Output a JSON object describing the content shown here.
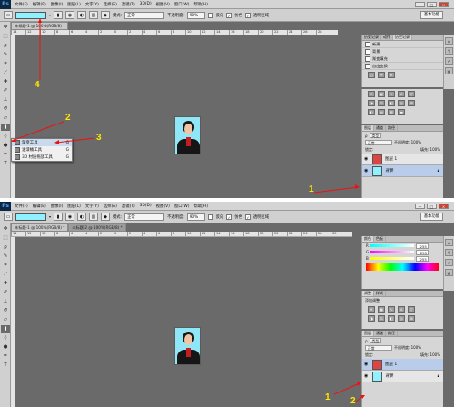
{
  "app": {
    "logo": "Ps"
  },
  "menu": [
    "文件(F)",
    "编辑(E)",
    "图像(I)",
    "图层(L)",
    "文字(Y)",
    "选择(S)",
    "滤镜(T)",
    "3D(D)",
    "视图(V)",
    "窗口(W)",
    "帮助(H)"
  ],
  "window_controls": [
    "—",
    "□",
    "×"
  ],
  "options": {
    "mode_label": "模式:",
    "mode_value": "正常",
    "opacity_label": "不透明度:",
    "opacity_value": "90%",
    "reverse_label": "反向",
    "dither_label": "仿色",
    "transparency_label": "透明区域",
    "workspace": "基本功能"
  },
  "screen1": {
    "tab": "未标题-1 @ 100%(RGB/8) *",
    "flyout": [
      {
        "label": "渐变工具",
        "key": "G"
      },
      {
        "label": "油漆桶工具",
        "key": "G"
      },
      {
        "label": "3D 材质拖放工具",
        "key": "G"
      }
    ],
    "history_tabs": [
      "历史记录",
      "动作",
      "历史记录"
    ],
    "history_items": [
      "新建",
      "背景",
      "渐变填充",
      "自由变换"
    ],
    "layers_tabs": [
      "图层",
      "通道",
      "路径"
    ],
    "layers_kind": "类型",
    "layers_blend": "正常",
    "layers_opacity": "不透明度: 100%",
    "layers_lock": "锁定:",
    "layers_fill": "填充: 100%",
    "layers": [
      {
        "name": "图层 1"
      },
      {
        "name": "背景"
      }
    ],
    "annotations": [
      "1",
      "2",
      "3",
      "4"
    ]
  },
  "screen2": {
    "tabs": [
      "未标题-1 @ 100%(RGB/8) *",
      "未标题-2 @ 100%(RGB/8) *"
    ],
    "color_tabs": [
      "颜色",
      "色板"
    ],
    "sliders": [
      {
        "label": "R",
        "value": "255"
      },
      {
        "label": "G",
        "value": "255"
      },
      {
        "label": "B",
        "value": "255"
      }
    ],
    "adjust_tabs": [
      "调整",
      "样式"
    ],
    "adjust_title": "添加调整",
    "layers_tabs": [
      "图层",
      "通道",
      "路径"
    ],
    "layers_kind": "类型",
    "layers_blend": "正常",
    "layers_opacity": "不透明度: 100%",
    "layers_lock": "锁定:",
    "layers_fill": "填充: 100%",
    "layers": [
      {
        "name": "图层 1"
      },
      {
        "name": "背景"
      }
    ],
    "annotations": [
      "1",
      "2"
    ]
  },
  "colors": {
    "gradient": "#8ff0ff",
    "annotation": "#ffe600",
    "canvas": "#6a6a6a"
  }
}
